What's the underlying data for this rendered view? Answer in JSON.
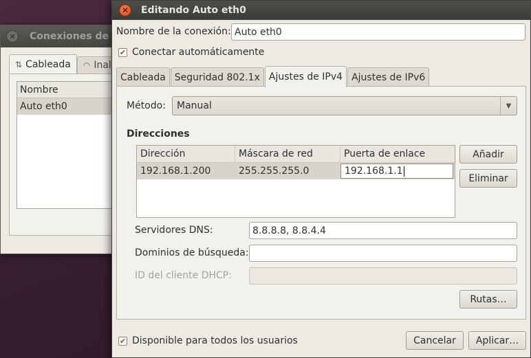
{
  "background_window": {
    "title": "Conexiones de r",
    "tabs": [
      {
        "label": "Cableada",
        "icon": "wired-network-icon"
      },
      {
        "label": "Inala",
        "icon": "wireless-icon"
      }
    ],
    "list_header": "Nombre",
    "list_items": [
      "Auto eth0"
    ]
  },
  "dialog": {
    "title": "Editando Auto eth0",
    "connection_name_label": "Nombre de la conexión:",
    "connection_name_value": "Auto eth0",
    "autoconnect_label": "Conectar automáticamente",
    "autoconnect_checked": true,
    "tabs": [
      "Cableada",
      "Seguridad 802.1x",
      "Ajustes de IPv4",
      "Ajustes de IPv6"
    ],
    "active_tab": "Ajustes de IPv4",
    "method_label": "Método:",
    "method_value": "Manual",
    "addresses_title": "Direcciones",
    "addresses_columns": [
      "Dirección",
      "Máscara de red",
      "Puerta de enlace"
    ],
    "addresses_rows": [
      {
        "address": "192.168.1.200",
        "netmask": "255.255.255.0",
        "gateway": "192.168.1.1"
      }
    ],
    "add_button": "Añadir",
    "remove_button": "Eliminar",
    "dns_label": "Servidores DNS:",
    "dns_value": "8.8.8.8, 8.8.4.4",
    "search_domains_label": "Dominios de búsqueda:",
    "search_domains_value": "",
    "dhcp_client_id_label": "ID del cliente DHCP:",
    "dhcp_client_id_value": "",
    "routes_button": "Rutas…",
    "all_users_label": "Disponible para todos los usuarios",
    "all_users_checked": true,
    "cancel_button": "Cancelar",
    "apply_button": "Aplicar…"
  },
  "colors": {
    "close_button": "#d94b19",
    "checkbox_mark": "#c4401f",
    "titlebar": "#3c3b37"
  }
}
